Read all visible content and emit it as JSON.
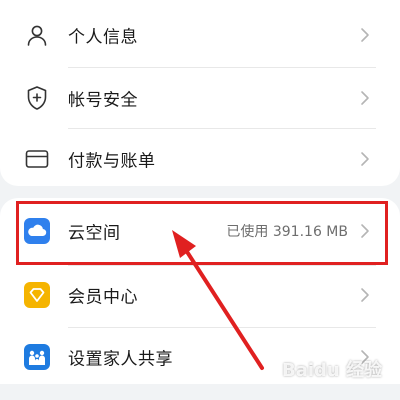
{
  "menu": {
    "personal_info": "个人信息",
    "account_security": "帐号安全",
    "payments_bills": "付款与账单",
    "cloud": "云空间",
    "cloud_usage": "已使用 391.16 MB",
    "membership": "会员中心",
    "family_sharing": "设置家人共享"
  },
  "icons": {
    "personal_info": "person-icon",
    "account_security": "shield-plus-icon",
    "payments_bills": "card-icon",
    "cloud": "cloud-icon",
    "membership": "diamond-icon",
    "family_sharing": "family-icon"
  },
  "colors": {
    "highlight": "#e02020",
    "cloud_icon": "#2f80ed",
    "membership_icon": "#f5b400",
    "family_icon": "#1e7be0"
  },
  "watermark": {
    "text": "Baidu 经验"
  }
}
